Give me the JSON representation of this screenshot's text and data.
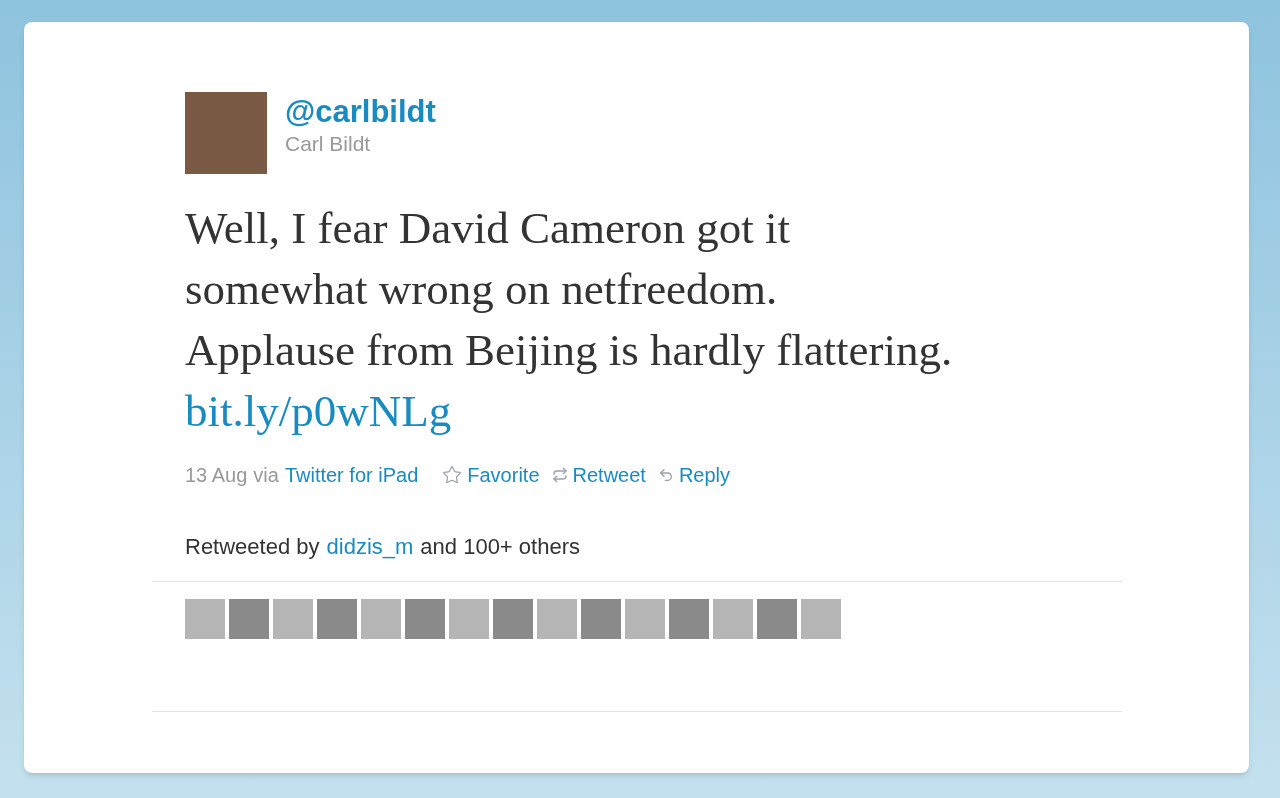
{
  "author": {
    "handle": "@carlbildt",
    "name": "Carl Bildt"
  },
  "tweet": {
    "lines": [
      "Well, I fear David Cameron got it",
      "somewhat wrong on netfreedom.",
      "Applause from Beijing is hardly flattering."
    ],
    "link": "bit.ly/p0wNLg"
  },
  "meta": {
    "date": "13 Aug",
    "via": "via",
    "source": "Twitter for iPad"
  },
  "actions": [
    {
      "kind": "favorite",
      "label": "Favorite"
    },
    {
      "kind": "retweet",
      "label": "Retweet"
    },
    {
      "kind": "reply",
      "label": "Reply"
    }
  ],
  "retweets": {
    "prefix": "Retweeted by",
    "user": "didzis_m",
    "suffix": "and 100+ others"
  }
}
